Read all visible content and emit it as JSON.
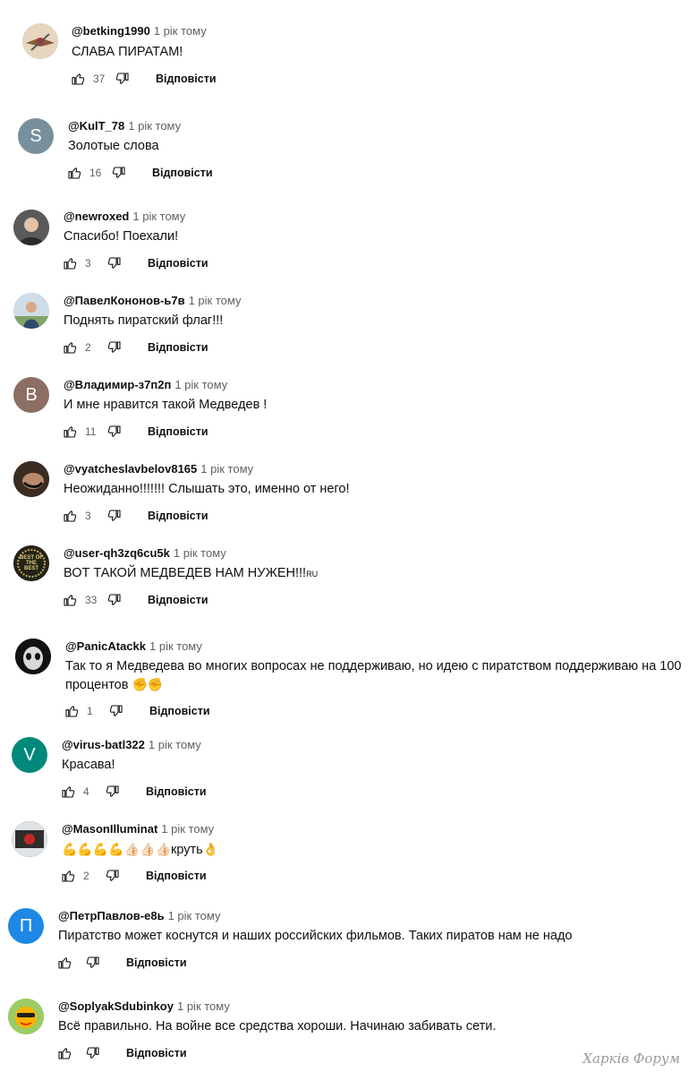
{
  "reply_label": "Відповісти",
  "watermark": "Харків Форум",
  "comments": [
    {
      "author": "@betking1990",
      "time": "1 рік тому",
      "text": "СЛАВА ПИРАТАМ!",
      "likes": "37",
      "avatar_letter": "",
      "avatar_color": "#c9a27a"
    },
    {
      "author": "@KulT_78",
      "time": "1 рік тому",
      "text": "Золотые слова",
      "likes": "16",
      "avatar_letter": "S",
      "avatar_color": "#78909c"
    },
    {
      "author": "@newroxed",
      "time": "1 рік тому",
      "text": "Спасибо! Поехали!",
      "likes": "3",
      "avatar_letter": "",
      "avatar_color": "#6b6b6b"
    },
    {
      "author": "@ПавелКононов-ь7в",
      "time": "1 рік тому",
      "text": "Поднять пиратский флаг!!!",
      "likes": "2",
      "avatar_letter": "",
      "avatar_color": "#8fa7c0"
    },
    {
      "author": "@Владимир-з7п2п",
      "time": "1 рік тому",
      "text": "И мне нравится такой Медведев !",
      "likes": "11",
      "avatar_letter": "В",
      "avatar_color": "#8d6e63"
    },
    {
      "author": "@vyatcheslavbelov8165",
      "time": "1 рік тому",
      "text": "Неожиданно!!!!!!! Слышать это, именно от него!",
      "likes": "3",
      "avatar_letter": "",
      "avatar_color": "#4a3a2e"
    },
    {
      "author": "@user-qh3zq6cu5k",
      "time": "1 рік тому",
      "text": "ВОТ ТАКОЙ МЕДВЕДЕВ НАМ НУЖЕН!!!",
      "text_suffix": "RU",
      "likes": "33",
      "avatar_letter": "",
      "avatar_color": "#2a2a20",
      "avatar_text": "BEST OF THE BEST"
    },
    {
      "author": "@PanicAtackk",
      "time": "1 рік тому",
      "text": "Так то я Медведева во многих вопросах не поддерживаю, но идею с пиратством поддерживаю на 100",
      "text_line2": "процентов",
      "text_emoji": "✊✊",
      "likes": "1",
      "avatar_letter": "",
      "avatar_color": "#111111"
    },
    {
      "author": "@virus-batl322",
      "time": "1 рік тому",
      "text": "Красава!",
      "likes": "4",
      "avatar_letter": "V",
      "avatar_color": "#00897b"
    },
    {
      "author": "@MasonIlluminat",
      "time": "1 рік тому",
      "text": "",
      "text_emoji": "💪💪💪💪👍🏻👍🏻👍🏻",
      "text_after": "круть",
      "text_after_emoji": "👌",
      "likes": "2",
      "avatar_letter": "",
      "avatar_color": "#3b3b3b"
    },
    {
      "author": "@ПетрПавлов-е8ь",
      "time": "1 рік тому",
      "text": "Пиратство может коснутся и наших российских фильмов. Таких пиратов нам не надо",
      "likes": "",
      "avatar_letter": "П",
      "avatar_color": "#1e88e5"
    },
    {
      "author": "@SoplyakSdubinkoy",
      "time": "1 рік тому",
      "text": "Всё правильно. На войне все средства хороши. Начинаю забивать сети.",
      "likes": "",
      "avatar_letter": "",
      "avatar_color": "#8bc34a"
    }
  ]
}
